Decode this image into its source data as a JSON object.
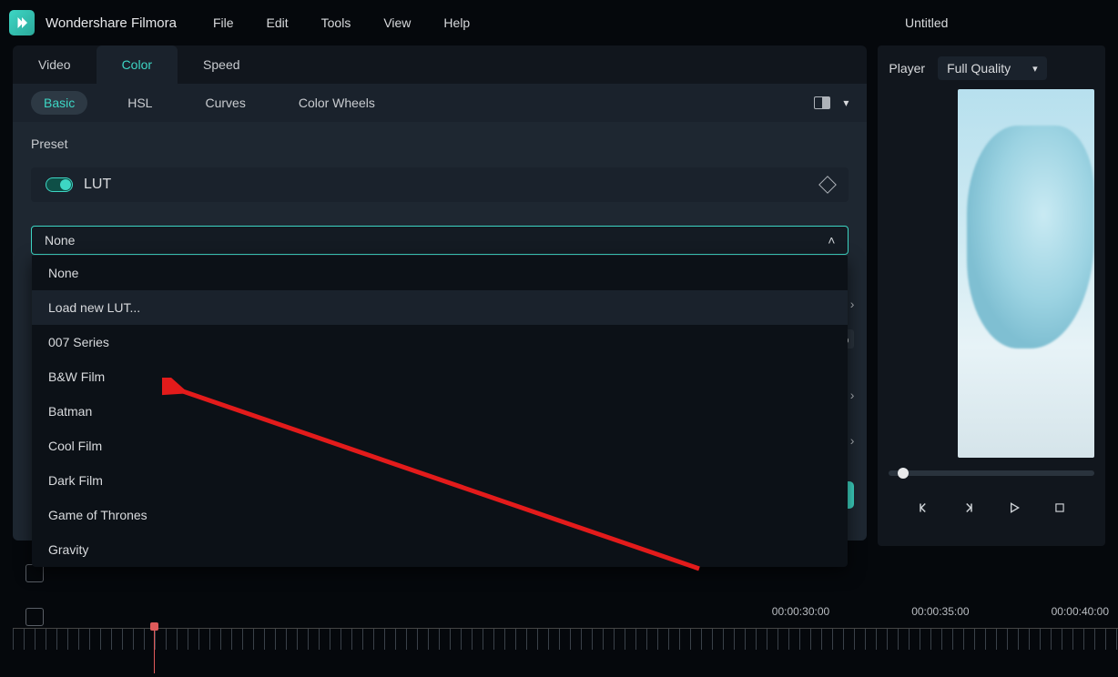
{
  "app": {
    "name": "Wondershare Filmora",
    "doc_title": "Untitled"
  },
  "menu": {
    "file": "File",
    "edit": "Edit",
    "tools": "Tools",
    "view": "View",
    "help": "Help"
  },
  "main_tabs": {
    "video": "Video",
    "color": "Color",
    "speed": "Speed"
  },
  "sub_tabs": {
    "basic": "Basic",
    "hsl": "HSL",
    "curves": "Curves",
    "wheels": "Color Wheels"
  },
  "preset": {
    "label": "Preset"
  },
  "lut": {
    "label": "LUT",
    "selected": "None",
    "percent": "%"
  },
  "lut_options": {
    "none": "None",
    "load": "Load new LUT...",
    "o007": "007 Series",
    "bw": "B&W Film",
    "batman": "Batman",
    "cool": "Cool Film",
    "dark": "Dark Film",
    "got": "Game of Thrones",
    "gravity": "Gravity"
  },
  "player": {
    "label": "Player",
    "quality": "Full Quality"
  },
  "timeline": {
    "t30": "00:00:30:00",
    "t35": "00:00:35:00",
    "t40": "00:00:40:00"
  }
}
